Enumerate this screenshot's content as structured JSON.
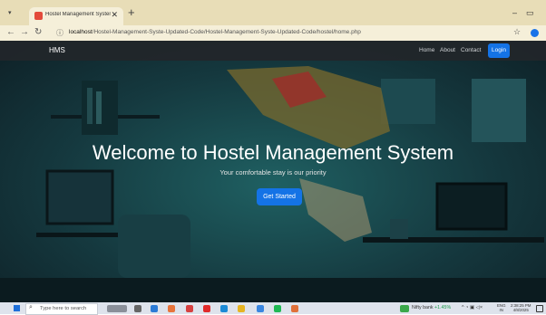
{
  "browser": {
    "tab_title": "Hostel Management System - ...",
    "new_tab_symbol": "+",
    "url_host": "localhost",
    "url_path": "/Hostel-Management-Syste-Updated-Code/Hostel-Management-Syste-Updated-Code/hostel/home.php"
  },
  "navbar": {
    "brand": "HMS",
    "links": [
      "Home",
      "About",
      "Contact"
    ],
    "login_label": "Login"
  },
  "hero": {
    "title": "Welcome to Hostel Management System",
    "subtitle": "Your comfortable stay is our priority",
    "cta_label": "Get Started"
  },
  "taskbar": {
    "search_placeholder": "Type here to search",
    "ticker_name": "Nifty bank",
    "ticker_change": "+1.45%",
    "lang_line1": "ENG",
    "lang_line2": "IN",
    "time": "2:38:25 PM",
    "date": "4/8/2025"
  }
}
